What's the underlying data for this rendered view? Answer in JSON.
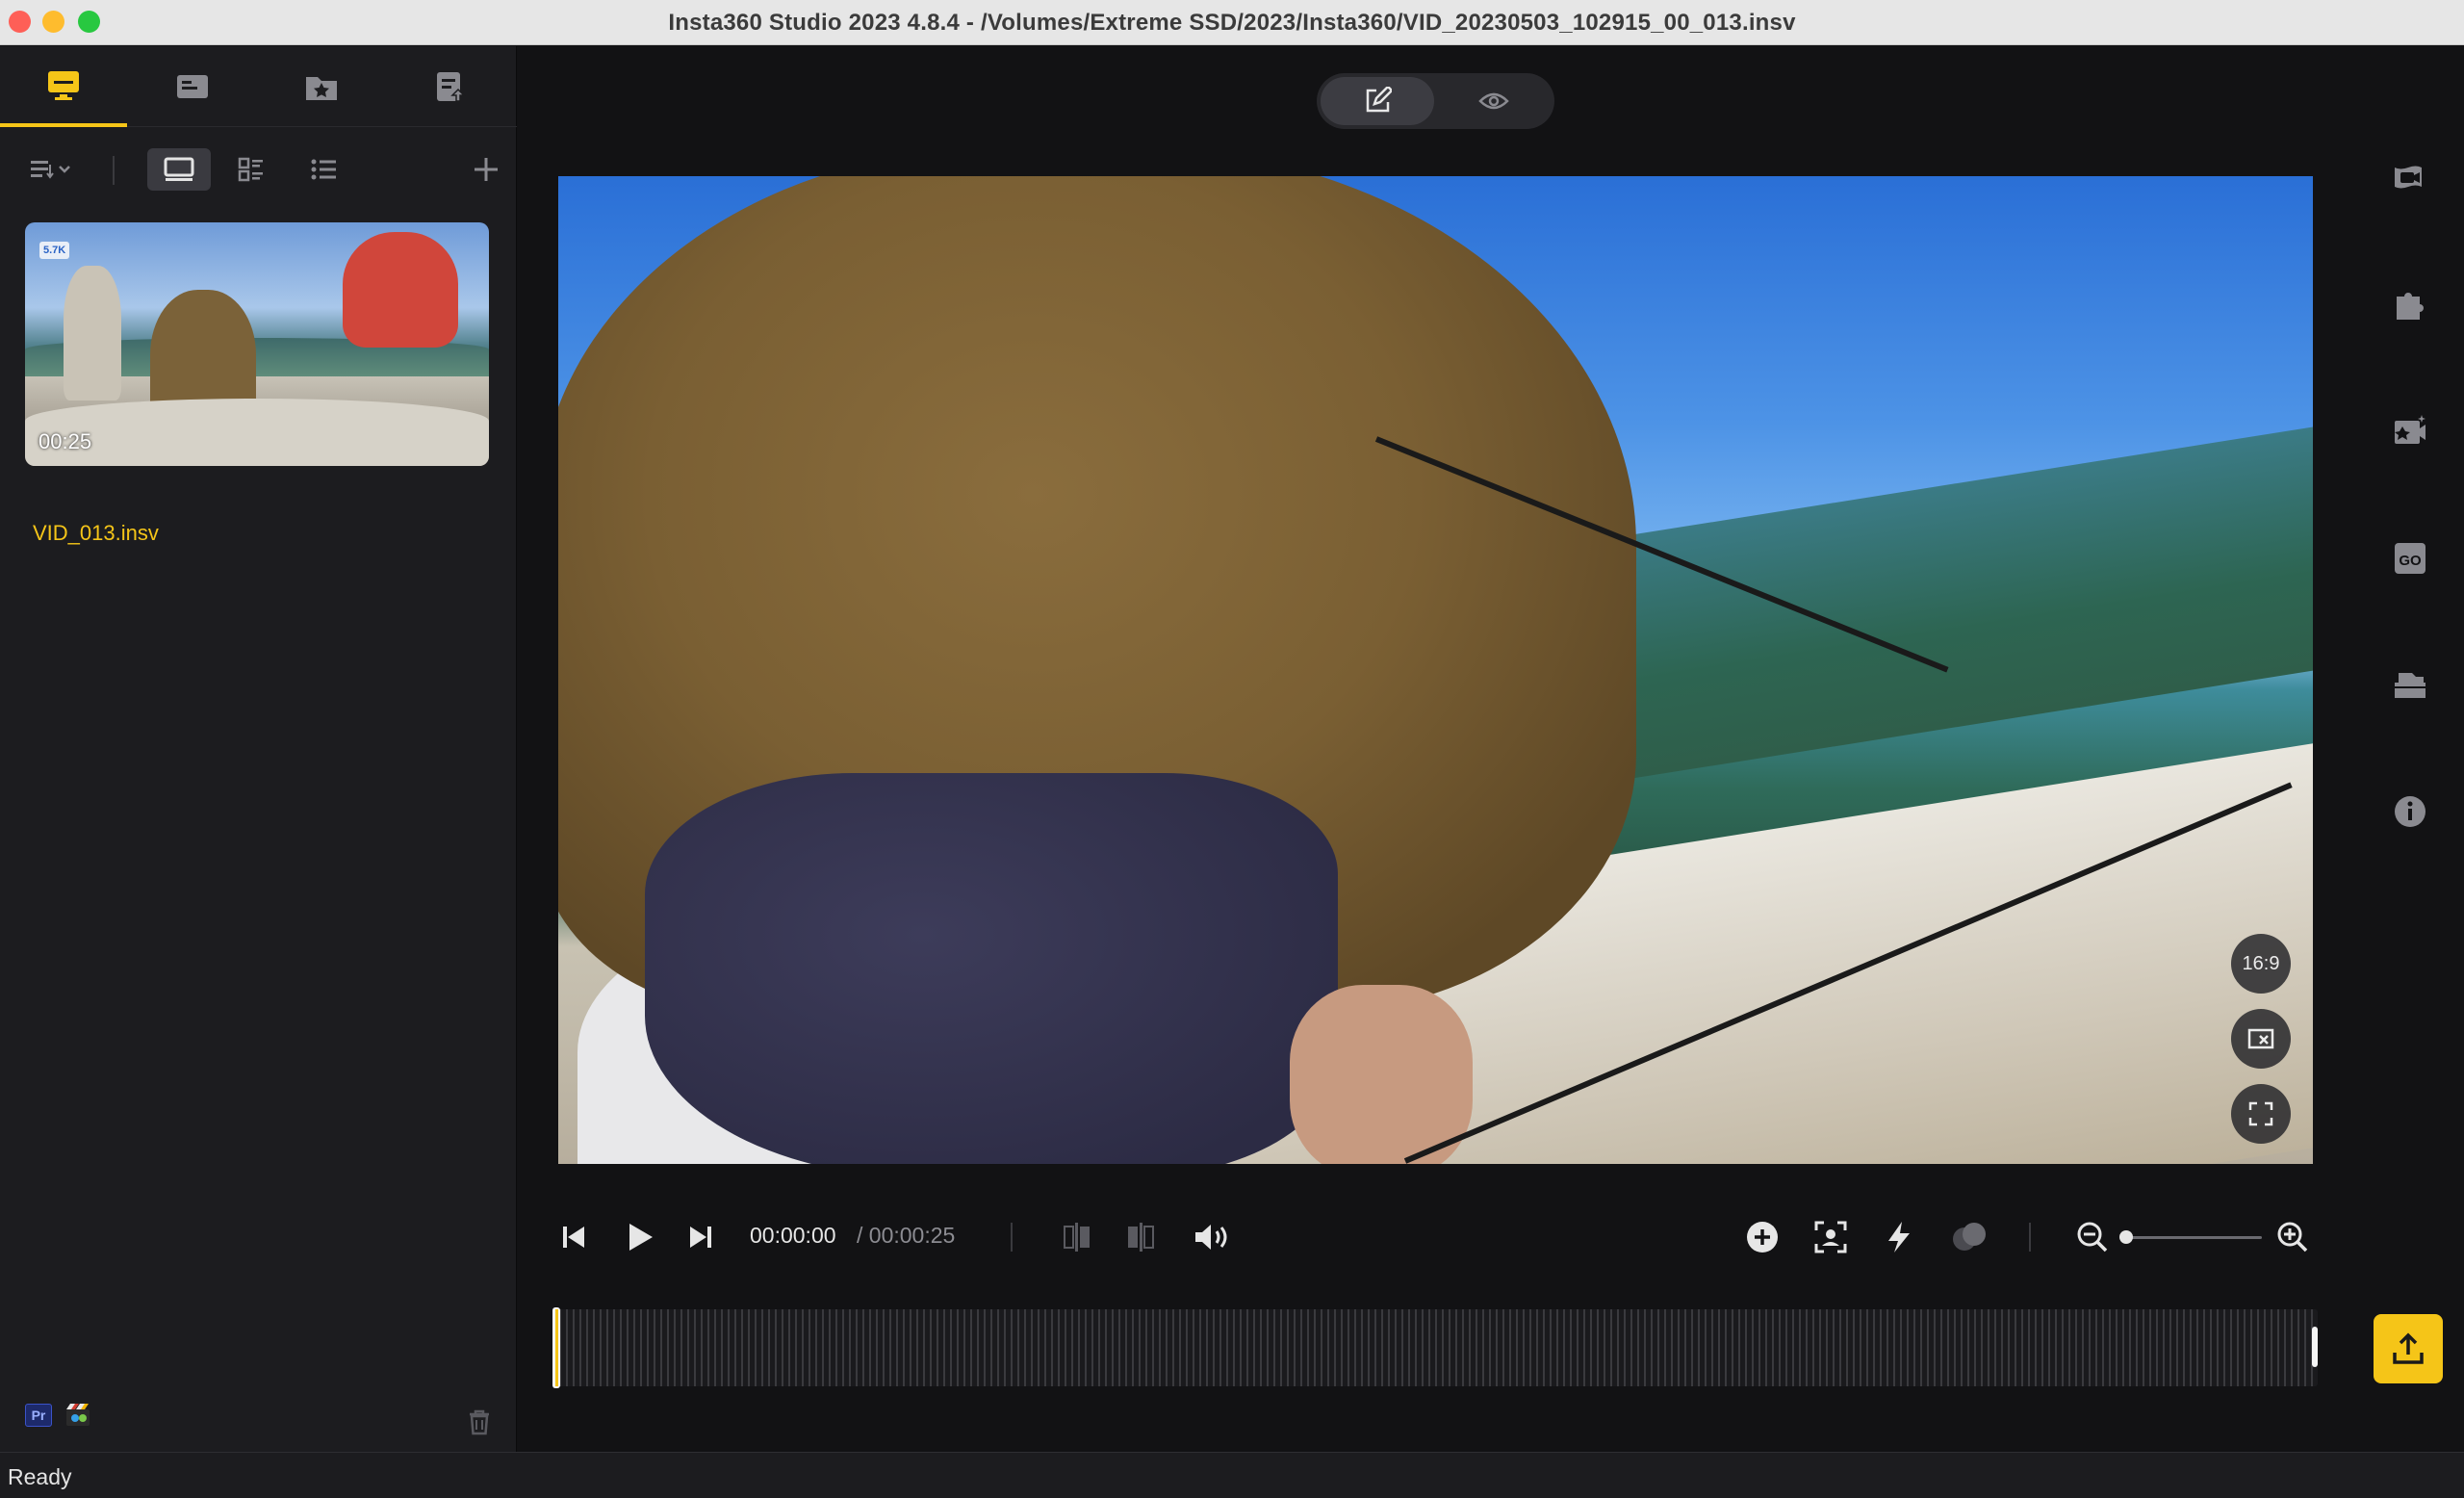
{
  "window": {
    "title": "Insta360 Studio 2023 4.8.4 - /Volumes/Extreme SSD/2023/Insta360/VID_20230503_102915_00_013.insv"
  },
  "left_tabs": [
    {
      "icon": "monitor-icon",
      "active": true
    },
    {
      "icon": "card-icon",
      "active": false
    },
    {
      "icon": "star-folder-icon",
      "active": false
    },
    {
      "icon": "export-list-icon",
      "active": false
    }
  ],
  "library": {
    "items": [
      {
        "name": "VID_013.insv",
        "duration": "00:25",
        "resolution_badge": "5.7K"
      }
    ]
  },
  "player": {
    "current_time": "00:00:00",
    "total_time": "/ 00:00:25",
    "zoom_level": 0.0
  },
  "viewer_buttons": {
    "aspect": "16:9"
  },
  "integrations": {
    "premiere": "Pr"
  },
  "status": {
    "text": "Ready"
  },
  "colors": {
    "accent": "#f5c518",
    "background": "#121214",
    "panel": "#1c1c1f"
  }
}
